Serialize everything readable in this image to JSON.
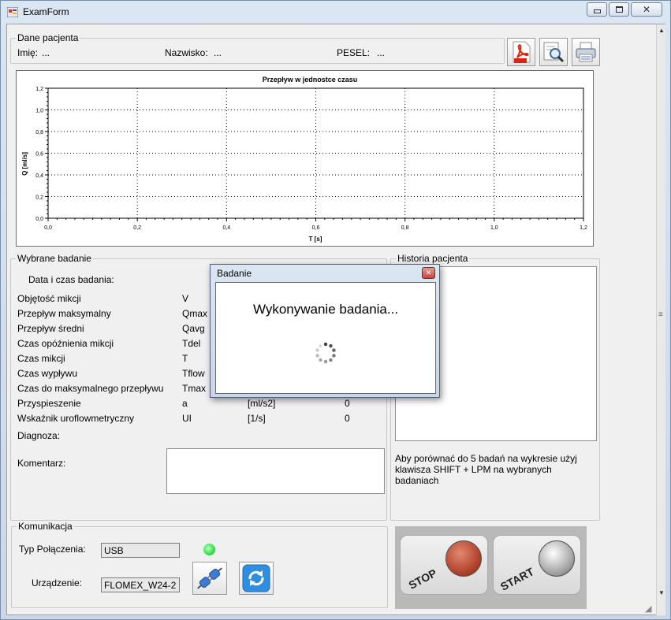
{
  "window": {
    "title": "ExamForm",
    "buttons": {
      "minimize": "▭",
      "maximize": "□",
      "close": "✕"
    }
  },
  "patient": {
    "group_title": "Dane pacjenta",
    "first_name_label": "Imię:",
    "first_name_value": "...",
    "last_name_label": "Nazwisko:",
    "last_name_value": "...",
    "pesel_label": "PESEL:",
    "pesel_value": "..."
  },
  "toolbar": {
    "icons": [
      "pdf-export-icon",
      "print-preview-icon",
      "printer-icon"
    ]
  },
  "chart_data": {
    "type": "line",
    "title": "Przepływ w jednostce czasu",
    "xlabel": "T [s]",
    "ylabel": "Q [ml/s]",
    "xlim": [
      0,
      1.2
    ],
    "ylim": [
      0,
      1.2
    ],
    "xticks": [
      "0,0",
      "0,2",
      "0,4",
      "0,6",
      "0,8",
      "1,0",
      "1,2"
    ],
    "yticks": [
      "0,0",
      "0,2",
      "0,4",
      "0,6",
      "0,8",
      "1,0",
      "1,2"
    ],
    "grid": true,
    "series": []
  },
  "exam": {
    "group_title": "Wybrane badanie",
    "datetime_label": "Data i czas badania:",
    "rows": [
      {
        "name": "Objętość mikcji",
        "symbol": "V",
        "unit": "",
        "value": ""
      },
      {
        "name": "Przepływ maksymalny",
        "symbol": "Qmax",
        "unit": "",
        "value": ""
      },
      {
        "name": "Przepływ średni",
        "symbol": "Qavg",
        "unit": "",
        "value": ""
      },
      {
        "name": "Czas opóźnienia mikcji",
        "symbol": "Tdel",
        "unit": "",
        "value": ""
      },
      {
        "name": "Czas mikcji",
        "symbol": "T",
        "unit": "",
        "value": ""
      },
      {
        "name": "Czas wypływu",
        "symbol": "Tflow",
        "unit": "",
        "value": ""
      },
      {
        "name": "Czas do maksymalnego przepływu",
        "symbol": "Tmax",
        "unit": "",
        "value": ""
      },
      {
        "name": "Przyspieszenie",
        "symbol": "a",
        "unit": "[ml/s2]",
        "value": "0"
      },
      {
        "name": "Wskaźnik uroflowmetryczny",
        "symbol": "UI",
        "unit": "[1/s]",
        "value": "0"
      }
    ],
    "diagnosis_label": "Diagnoza:",
    "comment_label": "Komentarz:"
  },
  "history": {
    "group_title": "Historia pacjenta",
    "hint": "Aby porównać do 5 badań na wykresie użyj klawisza SHIFT + LPM na wybranych badaniach"
  },
  "communication": {
    "group_title": "Komunikacja",
    "connection_label": "Typ Połączenia:",
    "connection_value": "USB",
    "device_label": "Urządzenie:",
    "device_value": "FLOMEX_W24-2",
    "status_color": "#33e04a"
  },
  "controls": {
    "stop_label": "STOP",
    "start_label": "START",
    "stop_color": "#b5442e",
    "start_color": "#9a9a9a"
  },
  "dialog": {
    "title": "Badanie",
    "message": "Wykonywanie badania..."
  }
}
